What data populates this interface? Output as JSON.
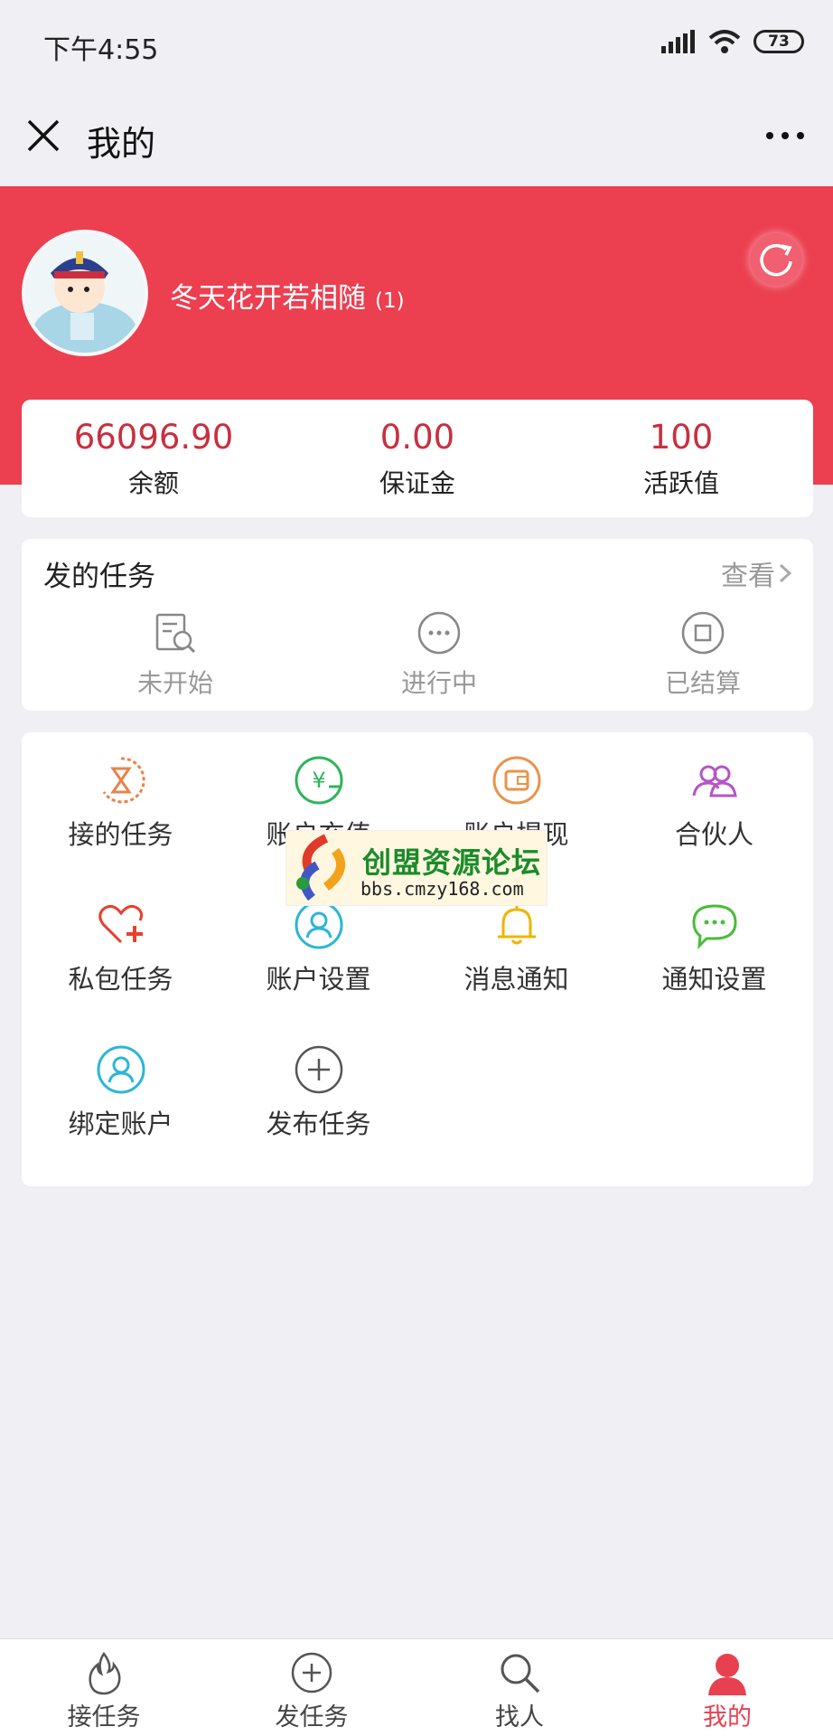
{
  "status_bar": {
    "time": "下午4:55",
    "battery": "73"
  },
  "nav": {
    "title": "我的"
  },
  "profile": {
    "username": "冬天花开若相随",
    "level": "(1)"
  },
  "stats": [
    {
      "value": "66096.90",
      "label": "余额"
    },
    {
      "value": "0.00",
      "label": "保证金"
    },
    {
      "value": "100",
      "label": "活跃值"
    }
  ],
  "tasks": {
    "title": "发的任务",
    "view_label": "查看",
    "items": [
      {
        "label": "未开始",
        "icon": "search-doc-icon"
      },
      {
        "label": "进行中",
        "icon": "ellipsis-circle-icon"
      },
      {
        "label": "已结算",
        "icon": "stop-circle-icon"
      }
    ]
  },
  "menu": {
    "items": [
      {
        "label": "接的任务",
        "icon": "hourglass-icon",
        "color": "#e8834a"
      },
      {
        "label": "账户充值",
        "icon": "yen-circle-icon",
        "color": "#2db45a"
      },
      {
        "label": "账户提现",
        "icon": "wallet-icon",
        "color": "#e8934a"
      },
      {
        "label": "合伙人",
        "icon": "users-icon",
        "color": "#b455c8"
      },
      {
        "label": "私包任务",
        "icon": "heart-plus-icon",
        "color": "#e8402e"
      },
      {
        "label": "账户设置",
        "icon": "user-circle-icon",
        "color": "#2bb6d6"
      },
      {
        "label": "消息通知",
        "icon": "bell-icon",
        "color": "#f0b400"
      },
      {
        "label": "通知设置",
        "icon": "chat-bubble-icon",
        "color": "#4cbb3c"
      },
      {
        "label": "绑定账户",
        "icon": "user-circle-icon",
        "color": "#2bb6d6"
      },
      {
        "label": "发布任务",
        "icon": "plus-circle-icon",
        "color": "#555555"
      }
    ]
  },
  "watermark": {
    "text": "创盟资源论坛",
    "url": "bbs.cmzy168.com"
  },
  "tabbar": {
    "items": [
      {
        "label": "接任务",
        "icon": "flame-icon"
      },
      {
        "label": "发任务",
        "icon": "plus-circle-icon"
      },
      {
        "label": "找人",
        "icon": "search-icon"
      },
      {
        "label": "我的",
        "icon": "person-icon",
        "active": true
      }
    ]
  },
  "colors": {
    "brand": "#ec3f50",
    "value_red": "#c8303f",
    "active_tab": "#e84050",
    "background": "#efeff4"
  }
}
